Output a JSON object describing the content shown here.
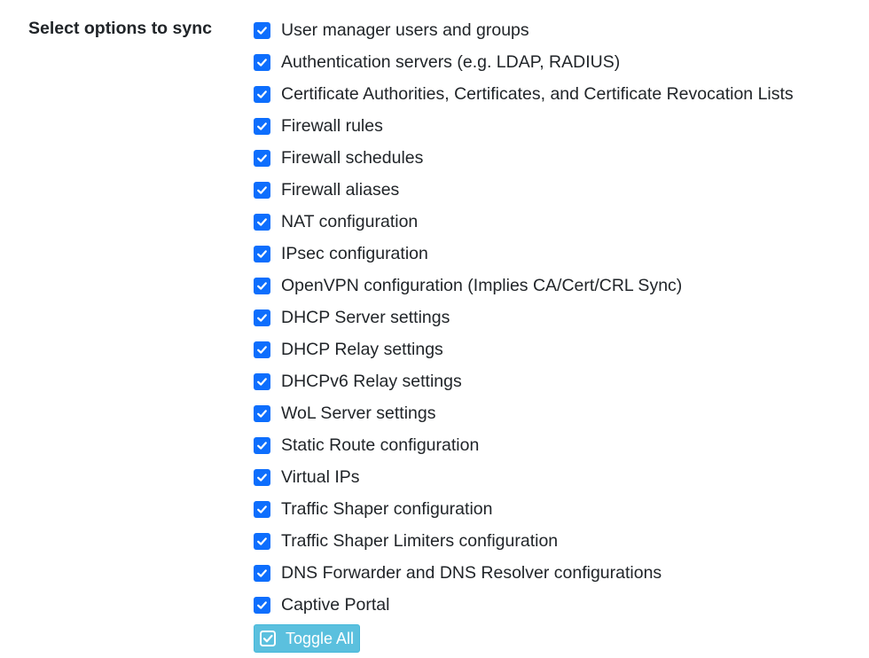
{
  "section": {
    "label": "Select options to sync"
  },
  "options": [
    {
      "label": "User manager users and groups",
      "checked": true
    },
    {
      "label": "Authentication servers (e.g. LDAP, RADIUS)",
      "checked": true
    },
    {
      "label": "Certificate Authorities, Certificates, and Certificate Revocation Lists",
      "checked": true
    },
    {
      "label": "Firewall rules",
      "checked": true
    },
    {
      "label": "Firewall schedules",
      "checked": true
    },
    {
      "label": "Firewall aliases",
      "checked": true
    },
    {
      "label": "NAT configuration",
      "checked": true
    },
    {
      "label": "IPsec configuration",
      "checked": true
    },
    {
      "label": "OpenVPN configuration (Implies CA/Cert/CRL Sync)",
      "checked": true
    },
    {
      "label": "DHCP Server settings",
      "checked": true
    },
    {
      "label": "DHCP Relay settings",
      "checked": true
    },
    {
      "label": "DHCPv6 Relay settings",
      "checked": true
    },
    {
      "label": "WoL Server settings",
      "checked": true
    },
    {
      "label": "Static Route configuration",
      "checked": true
    },
    {
      "label": "Virtual IPs",
      "checked": true
    },
    {
      "label": "Traffic Shaper configuration",
      "checked": true
    },
    {
      "label": "Traffic Shaper Limiters configuration",
      "checked": true
    },
    {
      "label": "DNS Forwarder and DNS Resolver configurations",
      "checked": true
    },
    {
      "label": "Captive Portal",
      "checked": true
    }
  ],
  "toggle_all": {
    "label": "Toggle All",
    "icon": "check-square-icon"
  },
  "colors": {
    "checkbox": "#0d6efd",
    "button": "#5bc0de",
    "text": "#212529"
  }
}
